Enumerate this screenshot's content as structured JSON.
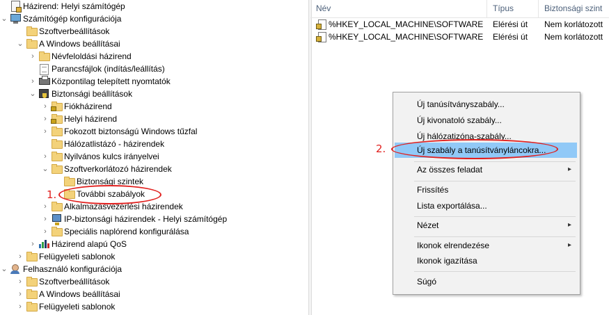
{
  "tree": {
    "items": [
      {
        "label": "Házirend: Helyi számítógép",
        "icon": "policy-document-icon"
      },
      {
        "label": "Számítógép konfigurációja",
        "icon": "computer-icon"
      },
      {
        "label": "Szoftverbeállítások",
        "icon": "folder-icon"
      },
      {
        "label": "A Windows beállításai",
        "icon": "folder-icon"
      },
      {
        "label": "Névfeloldási házirend",
        "icon": "folder-icon"
      },
      {
        "label": "Parancsfájlok (indítás/leállítás)",
        "icon": "script-document-icon"
      },
      {
        "label": "Központilag telepített nyomtatók",
        "icon": "printer-icon"
      },
      {
        "label": "Biztonsági beállítások",
        "icon": "security-computer-icon"
      },
      {
        "label": "Fiókházirend",
        "icon": "locked-folder-icon"
      },
      {
        "label": "Helyi házirend",
        "icon": "locked-folder-icon"
      },
      {
        "label": "Fokozott biztonságú Windows tűzfal",
        "icon": "folder-icon"
      },
      {
        "label": "Hálózatlistázó - házirendek",
        "icon": "folder-icon"
      },
      {
        "label": "Nyilvános kulcs irányelvei",
        "icon": "folder-icon"
      },
      {
        "label": "Szoftverkorlátozó házirendek",
        "icon": "folder-icon"
      },
      {
        "label": "Biztonsági szintek",
        "icon": "folder-icon"
      },
      {
        "label": "További szabályok",
        "icon": "folder-icon"
      },
      {
        "label": "Alkalmazásvezérlési házirendek",
        "icon": "folder-icon"
      },
      {
        "label": "IP-biztonsági házirendek - Helyi számítógép",
        "icon": "network-computer-icon"
      },
      {
        "label": "Speciális naplórend konfigurálása",
        "icon": "folder-icon"
      },
      {
        "label": "Házirend alapú QoS",
        "icon": "bar-chart-icon"
      },
      {
        "label": "Felügyeleti sablonok",
        "icon": "folder-icon"
      },
      {
        "label": "Felhasználó konfigurációja",
        "icon": "user-icon"
      },
      {
        "label": "Szoftverbeállítások",
        "icon": "folder-icon"
      },
      {
        "label": "A Windows beállításai",
        "icon": "folder-icon"
      },
      {
        "label": "Felügyeleti sablonok",
        "icon": "folder-icon"
      }
    ]
  },
  "list": {
    "columns": [
      "Név",
      "Típus",
      "Biztonsági szint"
    ],
    "rows": [
      {
        "name": "%HKEY_LOCAL_MACHINE\\SOFTWARE\\...",
        "type": "Elérési út",
        "level": "Nem korlátozott"
      },
      {
        "name": "%HKEY_LOCAL_MACHINE\\SOFTWARE\\...",
        "type": "Elérési út",
        "level": "Nem korlátozott"
      }
    ]
  },
  "context_menu": {
    "items": [
      "Új tanúsítványszabály...",
      "Új kivonatoló szabály...",
      "Új hálózatizóna-szabály...",
      "Új szabály a tanúsítványláncokra...",
      "Az összes feladat",
      "Frissítés",
      "Lista exportálása...",
      "Nézet",
      "Ikonok elrendezése",
      "Ikonok igazítása",
      "Súgó"
    ],
    "highlighted_index": 3
  },
  "annotations": {
    "step1": "1.",
    "step2": "2."
  },
  "colors": {
    "annotation": "#e1201e",
    "menu_highlight": "#91c9f7",
    "folder": "#f3d27a"
  }
}
